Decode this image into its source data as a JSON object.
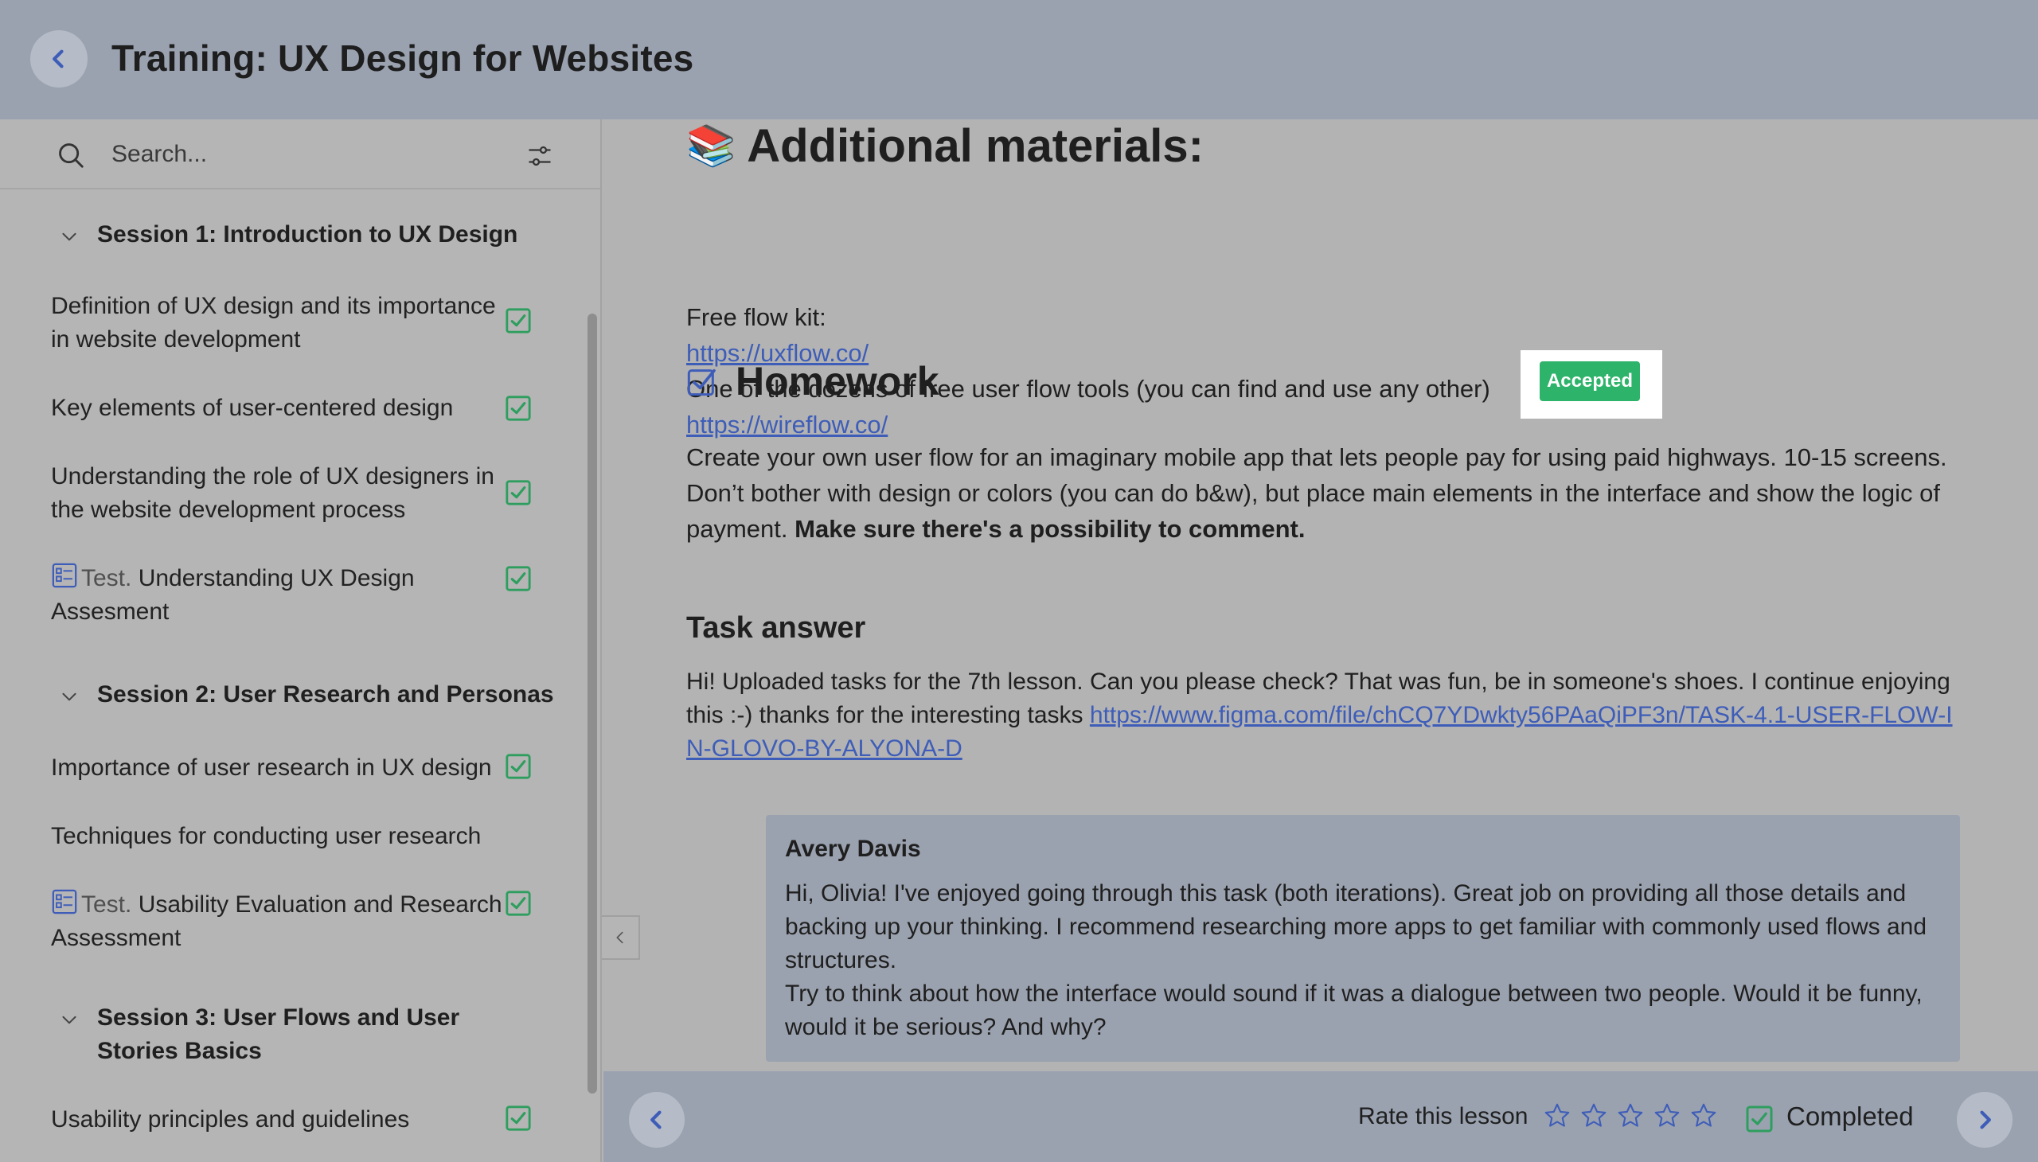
{
  "header": {
    "title": "Training: UX Design for Websites"
  },
  "sidebar": {
    "search_placeholder": "Search...",
    "sessions": [
      {
        "title": "Session 1: Introduction to UX Design",
        "lessons": [
          {
            "label": "Definition of UX design and its importance in website development",
            "completed": true
          },
          {
            "label": "Key elements of user-centered design",
            "completed": true
          },
          {
            "label": "Understanding the role of UX designers in the website development process",
            "completed": true
          },
          {
            "prefix": "Test.",
            "label": "Understanding UX Design Assesment",
            "completed": true
          }
        ]
      },
      {
        "title": "Session 2: User Research and Personas",
        "lessons": [
          {
            "label": "Importance of user research in UX design",
            "completed": true
          },
          {
            "label": "Techniques for conducting user research",
            "completed": false
          },
          {
            "prefix": "Test.",
            "label": "Usability Evaluation and Research Assessment",
            "completed": true
          }
        ]
      },
      {
        "title": "Session 3: User Flows and User Stories Basics",
        "lessons": [
          {
            "label": "Usability principles and guidelines",
            "completed": true
          }
        ]
      }
    ]
  },
  "main": {
    "materials": {
      "heading": "Additional materials:",
      "emoji": "📚",
      "line1": "Free flow kit:",
      "link1": "https://uxflow.co/",
      "line2": "One of the dozens of free user flow tools (you can find and use any other)",
      "link2": "https://wireflow.co/"
    },
    "homework": {
      "title": "Homework",
      "status": "Accepted",
      "text": "Create your own user flow for an imaginary mobile app that lets people pay for using paid highways. 10-15 screens. Don’t bother with design or colors (you can do b&w), but place main elements in the interface and show the logic of payment. ",
      "bold_text": "Make sure there's a possibility to comment."
    },
    "task_answer": {
      "heading": "Task answer",
      "text": "Hi! Uploaded tasks for the 7th lesson. Can you please check? That was fun, be in someone's shoes. I continue enjoying this :-) thanks for the interesting tasks ",
      "link": "https://www.figma.com/file/chCQ7YDwkty56PAaQiPF3n/TASK-4.1-USER-FLOW-IN-GLOVO-BY-ALYONA-D"
    },
    "comment": {
      "author": "Avery Davis",
      "line1": "Hi, Olivia! I've enjoyed going through this task (both iterations). Great job on providing all those details and backing up your thinking. I recommend researching more apps to get familiar with commonly used flows and structures.",
      "line2": "Try to think about how the interface would sound if it was a dialogue between two people. Would it be funny, would it be serious? And why?"
    }
  },
  "footer": {
    "rate_label": "Rate this lesson",
    "rating": 0,
    "max_rating": 5,
    "completed_label": "Completed"
  },
  "colors": {
    "accent": "#3e5db8",
    "check_green": "#2e9e5e",
    "badge_green": "#2db36a",
    "header_bg": "#9aa2b0"
  }
}
